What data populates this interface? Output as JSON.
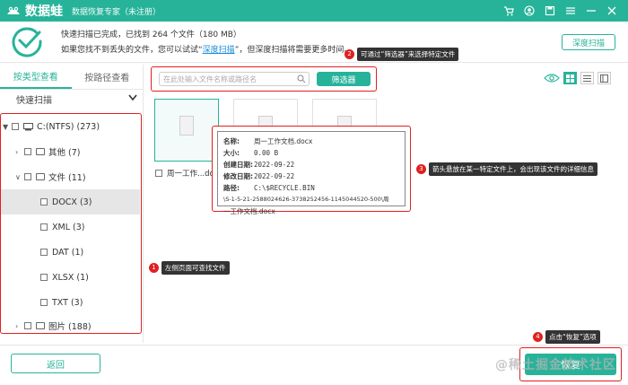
{
  "app": {
    "name": "数据蛙",
    "subtitle": "数据恢复专家（未注册）"
  },
  "status": {
    "line1": "快速扫描已完成，已找到 264 个文件（180 MB）",
    "line2_pre": "如果您找不到丢失的文件，您可以试试“",
    "line2_link": "深度扫描",
    "line2_post": "”，但深度扫描将需要更多时间。",
    "deep_scan_button": "深度扫描"
  },
  "left": {
    "tabs": [
      "按类型查看",
      "按路径查看"
    ],
    "quick_scan": "快速扫描",
    "tree": [
      {
        "label": "C:(NTFS) (273)"
      },
      {
        "label": "其他 (7)"
      },
      {
        "label": "文件 (11)"
      },
      {
        "label": "DOCX (3)"
      },
      {
        "label": "XML (3)"
      },
      {
        "label": "DAT (1)"
      },
      {
        "label": "XLSX (1)"
      },
      {
        "label": "TXT (3)"
      },
      {
        "label": "图片 (188)"
      }
    ]
  },
  "toolbar": {
    "search_placeholder": "在此处输入文件名称或路径名",
    "filter_button": "筛选器"
  },
  "files": [
    {
      "name": "周一工作...docx"
    }
  ],
  "tooltip": {
    "name_label": "名称:",
    "name": "周一工作文档.docx",
    "size_label": "大小:",
    "size": "0.00 B",
    "created_label": "创建日期:",
    "created": "2022-09-22",
    "modified_label": "修改日期:",
    "modified": "2022-09-22",
    "path_label": "路径:",
    "path1": "C:\\$RECYCLE.BIN",
    "path2": "\\S-1-5-21-2588024626-3738252456-1145044520-500\\周",
    "path3": "一工作文档.docx"
  },
  "callouts": [
    {
      "num": "1",
      "text": "左侧页面可查找文件"
    },
    {
      "num": "2",
      "text": "可通过“筛选器”来选择特定文件"
    },
    {
      "num": "3",
      "text": "箭头悬放在某一特定文件上，会出现该文件的详细信息"
    },
    {
      "num": "4",
      "text": "点击“恢复”选项"
    }
  ],
  "bottom": {
    "back_button": "返回",
    "recover_button": "恢复"
  },
  "watermark": "@稀土掘金技术社区",
  "colors": {
    "accent": "#27b39a",
    "annotation": "#e02020"
  }
}
